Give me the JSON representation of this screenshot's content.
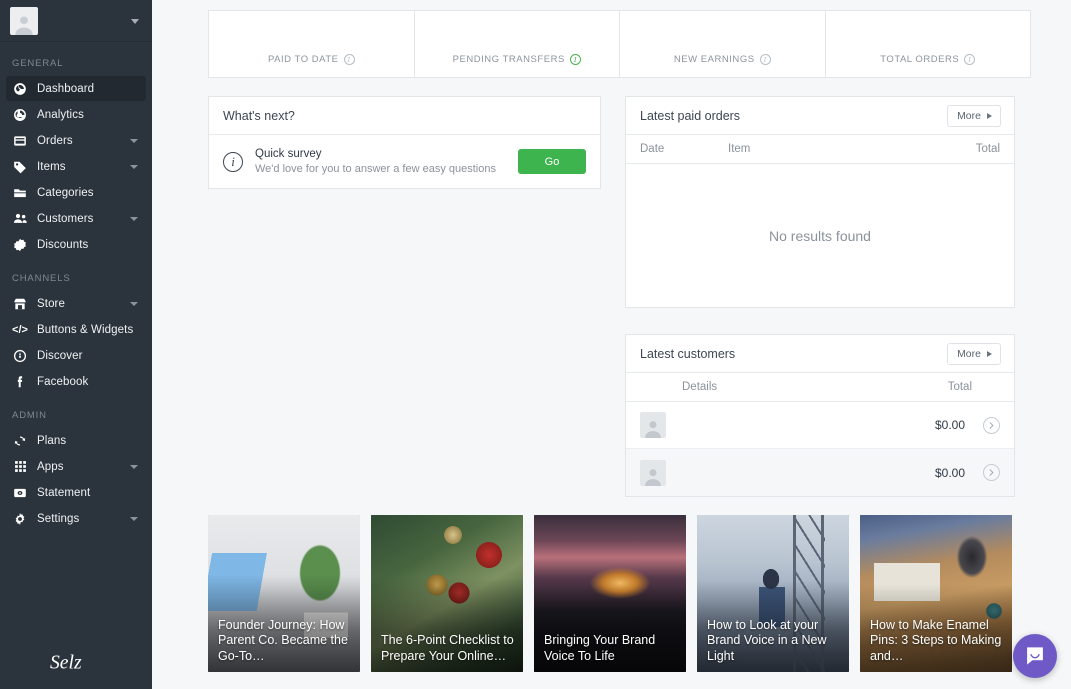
{
  "sidebar": {
    "account": {
      "avatar_icon": "user-avatar-icon",
      "caret_icon": "chevron-down-icon"
    },
    "sections": [
      {
        "label": "GENERAL",
        "items": [
          {
            "label": "Dashboard",
            "icon": "dashboard-icon",
            "active": true,
            "expandable": false
          },
          {
            "label": "Analytics",
            "icon": "analytics-icon",
            "active": false,
            "expandable": false
          },
          {
            "label": "Orders",
            "icon": "orders-icon",
            "active": false,
            "expandable": true
          },
          {
            "label": "Items",
            "icon": "tag-icon",
            "active": false,
            "expandable": true
          },
          {
            "label": "Categories",
            "icon": "folder-icon",
            "active": false,
            "expandable": false
          },
          {
            "label": "Customers",
            "icon": "people-icon",
            "active": false,
            "expandable": true
          },
          {
            "label": "Discounts",
            "icon": "discount-icon",
            "active": false,
            "expandable": false
          }
        ]
      },
      {
        "label": "CHANNELS",
        "items": [
          {
            "label": "Store",
            "icon": "store-icon",
            "active": false,
            "expandable": true
          },
          {
            "label": "Buttons & Widgets",
            "icon": "code-icon",
            "active": false,
            "expandable": false
          },
          {
            "label": "Discover",
            "icon": "discover-icon",
            "active": false,
            "expandable": false
          },
          {
            "label": "Facebook",
            "icon": "facebook-icon",
            "active": false,
            "expandable": false
          }
        ]
      },
      {
        "label": "ADMIN",
        "items": [
          {
            "label": "Plans",
            "icon": "refresh-icon",
            "active": false,
            "expandable": false
          },
          {
            "label": "Apps",
            "icon": "grid-icon",
            "active": false,
            "expandable": true
          },
          {
            "label": "Statement",
            "icon": "statement-icon",
            "active": false,
            "expandable": false
          },
          {
            "label": "Settings",
            "icon": "gear-icon",
            "active": false,
            "expandable": true
          }
        ]
      }
    ],
    "logo_text": "Selz"
  },
  "stats": [
    {
      "label": "PAID TO DATE",
      "value": "",
      "info_icon": "info-icon",
      "info_color": "#b6bec6"
    },
    {
      "label": "PENDING TRANSFERS",
      "value": "",
      "info_icon": "info-icon",
      "info_color": "#4cb050"
    },
    {
      "label": "NEW EARNINGS",
      "value": "",
      "info_icon": "info-icon",
      "info_color": "#b6bec6"
    },
    {
      "label": "TOTAL ORDERS",
      "value": "",
      "info_icon": "info-icon",
      "info_color": "#b6bec6"
    }
  ],
  "whats_next": {
    "title": "What's next?",
    "item": {
      "icon": "info-circle-icon",
      "title": "Quick survey",
      "subtitle": "We'd love for you to answer a few easy questions",
      "button_label": "Go"
    }
  },
  "latest_paid_orders": {
    "title": "Latest paid orders",
    "more_label": "More",
    "columns": {
      "date": "Date",
      "item": "Item",
      "total": "Total"
    },
    "empty_message": "No results found",
    "rows": []
  },
  "latest_customers": {
    "title": "Latest customers",
    "more_label": "More",
    "columns": {
      "details": "Details",
      "total": "Total"
    },
    "rows": [
      {
        "avatar_icon": "user-avatar-icon",
        "name": "",
        "total": "$0.00",
        "go_icon": "chevron-right-icon"
      },
      {
        "avatar_icon": "user-avatar-icon",
        "name": "",
        "total": "$0.00",
        "go_icon": "chevron-right-icon"
      }
    ]
  },
  "articles": [
    {
      "title": "Founder Journey: How Parent Co. Became the Go-To…"
    },
    {
      "title": "The 6-Point Checklist to Prepare Your Online…"
    },
    {
      "title": "Bringing Your Brand Voice To Life"
    },
    {
      "title": "How to Look at your Brand Voice in a New Light"
    },
    {
      "title": "How to Make Enamel Pins: 3 Steps to Making and…"
    }
  ],
  "chat_widget": {
    "icon": "chat-bubble-icon",
    "color": "#6e59c7"
  },
  "colors": {
    "sidebar_bg": "#2b333c",
    "page_bg": "#f6f7f8",
    "accent_green": "#3eb44f",
    "info_green": "#4cb050",
    "chat_purple": "#6e59c7"
  }
}
